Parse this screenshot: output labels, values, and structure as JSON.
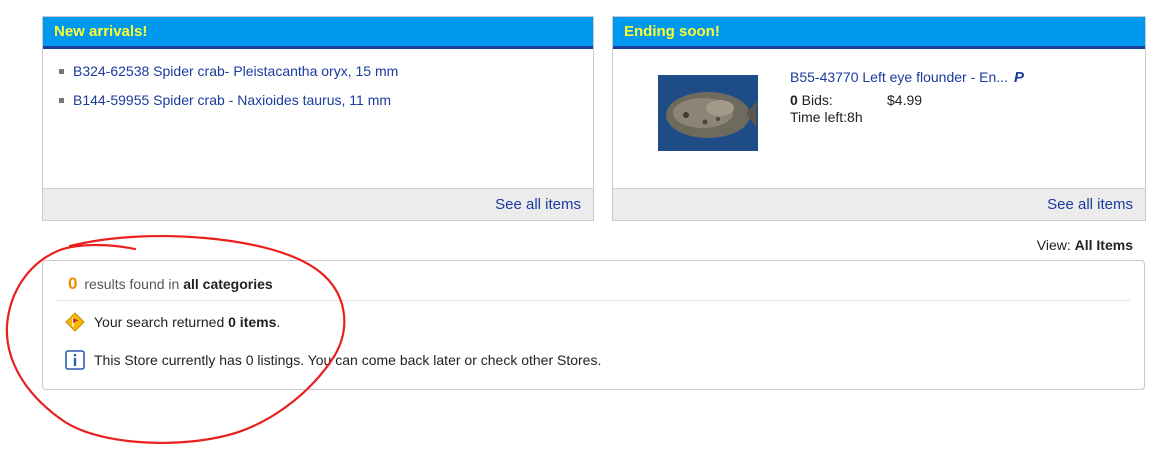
{
  "new_arrivals": {
    "title": "New arrivals!",
    "items": [
      {
        "label": "B324-62538 Spider crab- Pleistacantha oryx, 15 mm"
      },
      {
        "label": "B144-59955 Spider crab - Naxioides taurus, 11 mm"
      }
    ],
    "see_all": "See all items"
  },
  "ending_soon": {
    "title": "Ending soon!",
    "item": {
      "title": "B55-43770 Left eye flounder - En...",
      "bids_count": "0",
      "bids_label": " Bids:",
      "price": "$4.99",
      "time_left": "Time left:8h",
      "thumbnail_icon": "flounder-photo",
      "payment_icon": "paypal-icon"
    },
    "see_all": "See all items"
  },
  "view": {
    "label": "View: ",
    "value": "All Items"
  },
  "results": {
    "count": "0",
    "text_pre": "results found in ",
    "scope": "all categories",
    "search_msg_pre": "Your search returned ",
    "search_msg_bold": "0 items",
    "search_msg_post": ".",
    "store_msg": "This Store currently has 0 listings. You can come back later or check other Stores."
  },
  "colors": {
    "header_bg": "#0099ee",
    "header_text": "#ffff33",
    "link": "#1a3b9f",
    "count_orange": "#f08a00",
    "annotation_red": "#e8211f"
  }
}
